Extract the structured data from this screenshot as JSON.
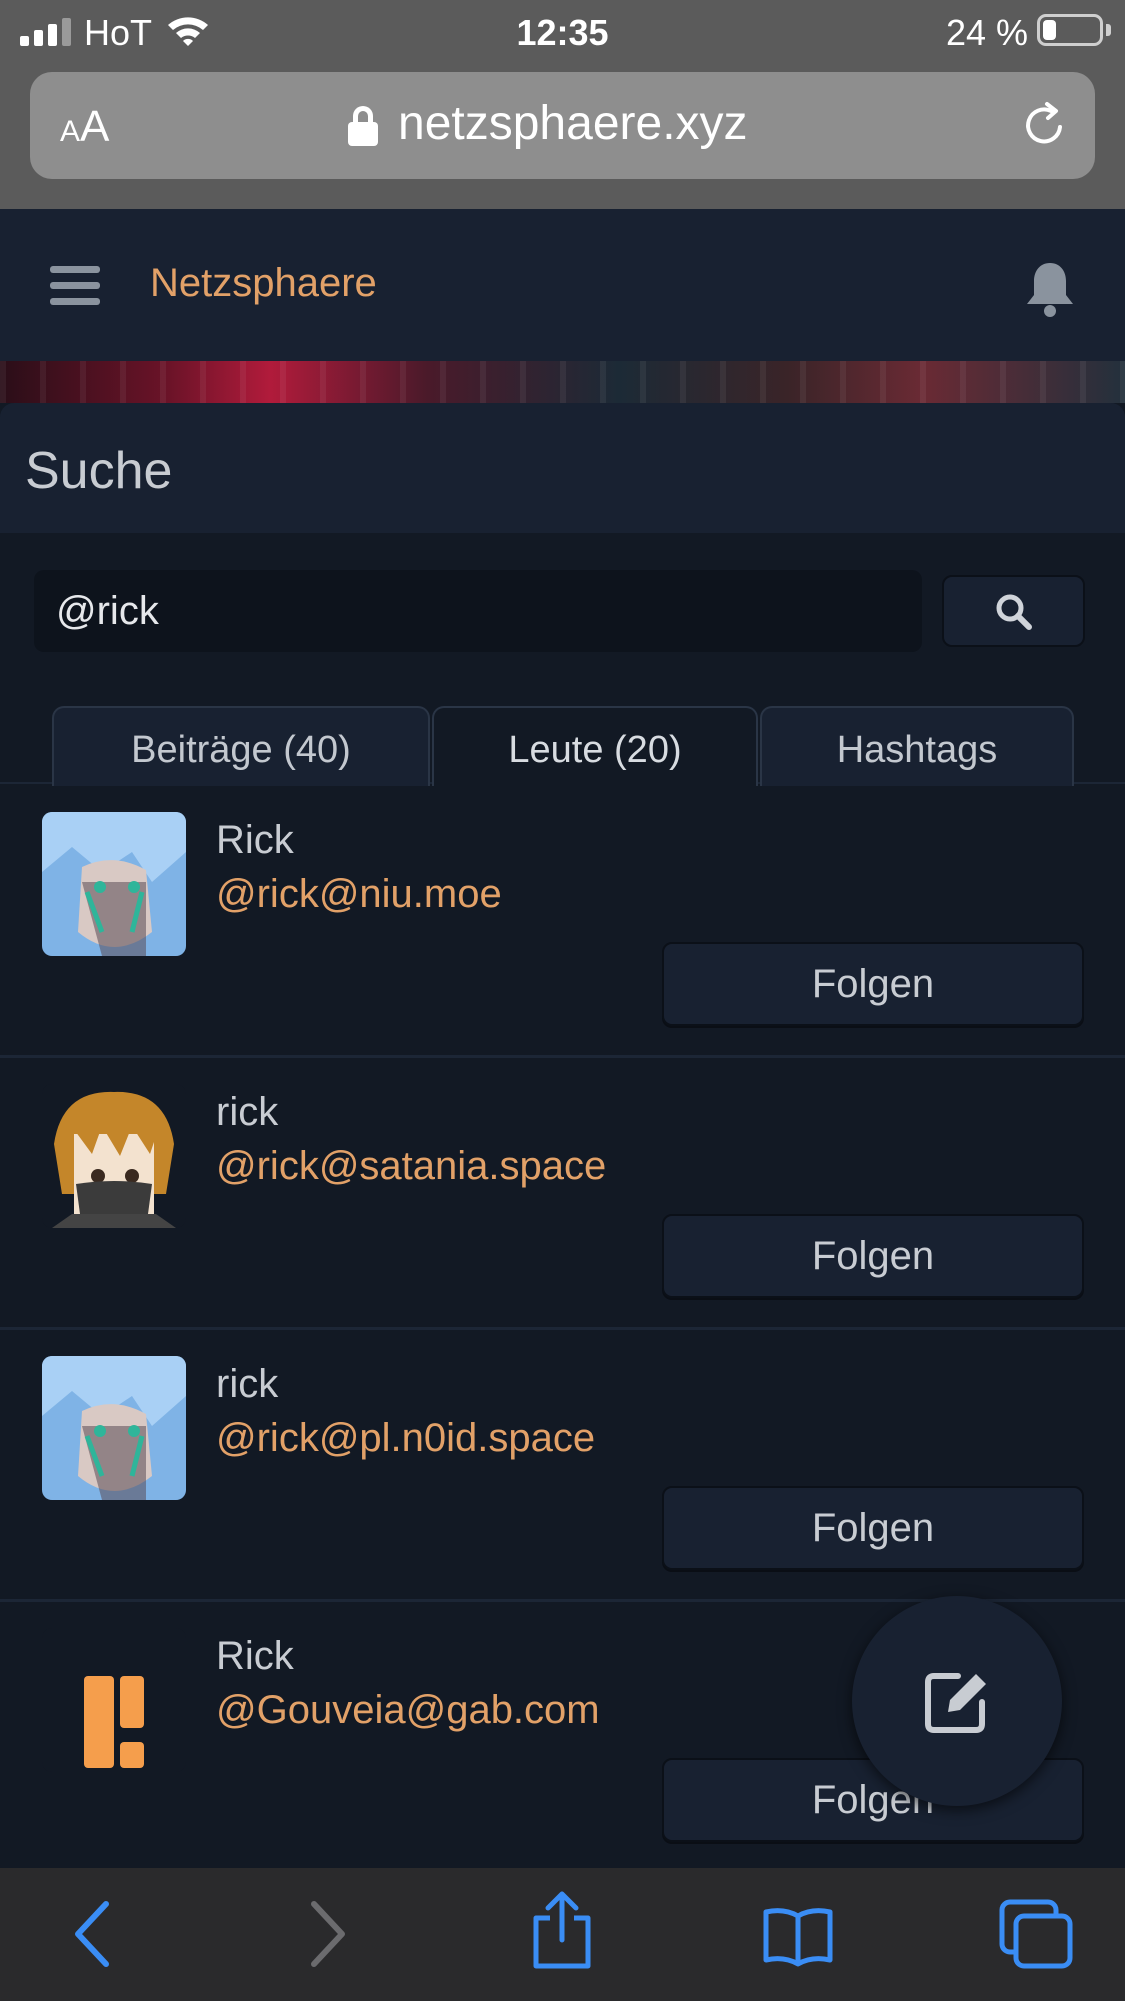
{
  "status_bar": {
    "carrier": "HoT",
    "time": "12:35",
    "battery_percent_text": "24 %",
    "battery_level": 0.24,
    "signal_bars": 3
  },
  "browser": {
    "text_size_label": "AA",
    "url": "netzsphaere.xyz"
  },
  "site": {
    "brand": "Netzsphaere",
    "accent_color": "#e2a168"
  },
  "search": {
    "title": "Suche",
    "query": "@rick",
    "tabs": [
      {
        "label": "Beiträge (40)",
        "active": false
      },
      {
        "label": "Leute (20)",
        "active": true
      },
      {
        "label": "Hashtags",
        "active": false
      }
    ]
  },
  "results": [
    {
      "name": "Rick",
      "handle": "@rick@niu.moe",
      "avatar": "blue-hair-anime-avatar",
      "follow_label": "Folgen"
    },
    {
      "name": "rick",
      "handle": "@rick@satania.space",
      "avatar": "masked-anime-avatar",
      "follow_label": "Folgen"
    },
    {
      "name": "rick",
      "handle": "@rick@pl.n0id.space",
      "avatar": "blue-hair-anime-avatar",
      "follow_label": "Folgen"
    },
    {
      "name": "Rick",
      "handle": "@Gouveia@gab.com",
      "avatar": "gab-logo-avatar",
      "follow_label": "Folgen"
    }
  ],
  "fab": {
    "icon": "compose-icon"
  },
  "toolbar": {
    "icons": [
      "back-icon",
      "forward-icon",
      "share-icon",
      "bookmarks-icon",
      "tabs-icon"
    ]
  }
}
